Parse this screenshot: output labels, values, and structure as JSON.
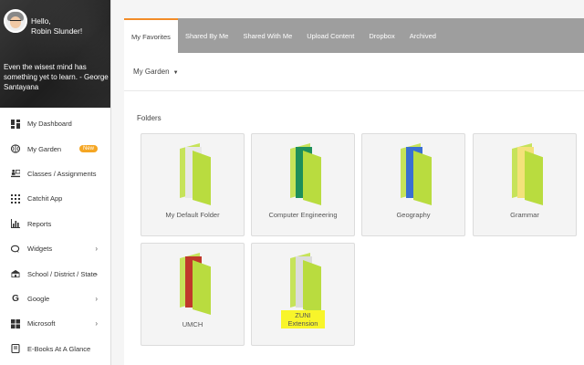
{
  "profile": {
    "greeting_line1": "Hello,",
    "greeting_line2": "Robin Slunder!",
    "quote": "Even the wisest mind has something yet to learn. - George Santayana"
  },
  "nav": [
    {
      "label": "My Dashboard",
      "icon": "dashboard-icon"
    },
    {
      "label": "My Garden",
      "icon": "brain-icon",
      "badge": "New"
    },
    {
      "label": "Classes / Assignments",
      "icon": "classroom-icon"
    },
    {
      "label": "Catchit App",
      "icon": "grid-icon"
    },
    {
      "label": "Reports",
      "icon": "bar-chart-icon"
    },
    {
      "label": "Widgets",
      "icon": "chat-icon",
      "chevron": true
    },
    {
      "label": "School / District / State",
      "icon": "school-icon",
      "chevron": true
    },
    {
      "label": "Google",
      "icon": "google-icon",
      "chevron": true
    },
    {
      "label": "Microsoft",
      "icon": "windows-icon",
      "chevron": true
    },
    {
      "label": "E-Books At A Glance",
      "icon": "book-icon"
    }
  ],
  "tabs": [
    "My Favorites",
    "Shared By Me",
    "Shared With Me",
    "Upload Content",
    "Dropbox",
    "Archived"
  ],
  "active_tab": "My Favorites",
  "garden_dropdown": "My Garden",
  "folders_heading": "Folders",
  "folders": [
    {
      "name": "My Default Folder",
      "paper": "#e8e8e8"
    },
    {
      "name": "Computer Engineering",
      "paper": "#1e8f5a"
    },
    {
      "name": "Geography",
      "paper": "#3a6fd1"
    },
    {
      "name": "Grammar",
      "paper": "#f3e27a"
    },
    {
      "name": "UMCH",
      "paper": "#c0392b"
    },
    {
      "name": "ZUNI Extension",
      "paper": "#dcdcdc",
      "highlight": true
    }
  ],
  "colors": {
    "accent": "#f28c28",
    "folder_green": "#b9dc3f",
    "tab_bar": "#9e9e9e",
    "highlight": "#f8f52a"
  }
}
